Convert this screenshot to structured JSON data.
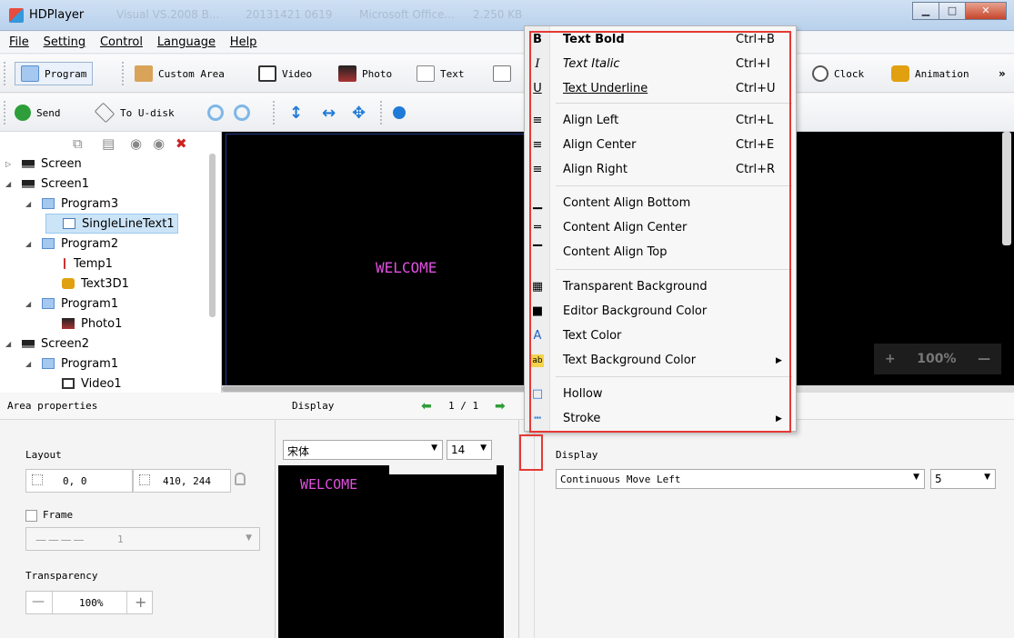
{
  "window": {
    "title": "HDPlayer",
    "ghost_tabs": [
      "Visual VS.2008 B...",
      "20131421 0619",
      "Microsoft Office...",
      "2.250 KB"
    ]
  },
  "menubar": [
    "File",
    "Setting",
    "Control",
    "Language",
    "Help"
  ],
  "toolbar1": {
    "program": "Program",
    "custom_area": "Custom Area",
    "video": "Video",
    "photo": "Photo",
    "text": "Text",
    "clock": "Clock",
    "animation": "Animation",
    "more": "»"
  },
  "toolbar2": {
    "send": "Send",
    "to_udisk": "To U-disk"
  },
  "tree": [
    {
      "label": "Screen",
      "level": 0,
      "arrow": "▷",
      "icon": "monitor-icon"
    },
    {
      "label": "Screen1",
      "level": 0,
      "arrow": "◢",
      "icon": "monitor-icon"
    },
    {
      "label": "Program3",
      "level": 1,
      "arrow": "◢",
      "icon": "program-icon"
    },
    {
      "label": "SingleLineText1",
      "level": 2,
      "arrow": "",
      "icon": "text-icon",
      "selected": true
    },
    {
      "label": "Program2",
      "level": 1,
      "arrow": "◢",
      "icon": "program-icon"
    },
    {
      "label": "Temp1",
      "level": 2,
      "arrow": "",
      "icon": "thermometer-icon"
    },
    {
      "label": "Text3D1",
      "level": 2,
      "arrow": "",
      "icon": "text3d-icon"
    },
    {
      "label": "Program1",
      "level": 1,
      "arrow": "◢",
      "icon": "program-icon"
    },
    {
      "label": "Photo1",
      "level": 2,
      "arrow": "",
      "icon": "photo-icon"
    },
    {
      "label": "Screen2",
      "level": 0,
      "arrow": "◢",
      "icon": "monitor-icon"
    },
    {
      "label": "Program1",
      "level": 1,
      "arrow": "◢",
      "icon": "program-icon"
    },
    {
      "label": "Video1",
      "level": 2,
      "arrow": "",
      "icon": "video-icon"
    }
  ],
  "canvas": {
    "text": "WELCOME",
    "zoom": "100%",
    "zoom_in": "+",
    "zoom_out": "—"
  },
  "area": {
    "header": "Area properties",
    "layout_label": "Layout",
    "position": "0, 0",
    "size": "410, 244",
    "frame_label": "Frame",
    "frame_value": "1",
    "transparency_label": "Transparency",
    "transparency_value": "100%",
    "minus": "—",
    "plus": "+"
  },
  "display": {
    "header": "Display",
    "page": "1 / 1",
    "font": "宋体",
    "font_size": "14",
    "preview_text": "WELCOME",
    "expand": "»"
  },
  "right_panel": {
    "display_label": "Display",
    "effect": "Continuous Move Left",
    "speed": "5"
  },
  "context_menu": [
    {
      "label": "Text Bold",
      "shortcut": "Ctrl+B",
      "icon": "bold-icon",
      "glyph": "B"
    },
    {
      "label": "Text Italic",
      "shortcut": "Ctrl+I",
      "icon": "italic-icon",
      "glyph": "I"
    },
    {
      "label": "Text Underline",
      "shortcut": "Ctrl+U",
      "icon": "underline-icon",
      "glyph": "U"
    },
    {
      "label": "Align Left",
      "shortcut": "Ctrl+L",
      "icon": "align-left-icon",
      "glyph": "≡"
    },
    {
      "label": "Align Center",
      "shortcut": "Ctrl+E",
      "icon": "align-center-icon",
      "glyph": "≡"
    },
    {
      "label": "Align Right",
      "shortcut": "Ctrl+R",
      "icon": "align-right-icon",
      "glyph": "≡"
    },
    {
      "label": "Content Align Bottom",
      "shortcut": "",
      "icon": "content-bottom-icon",
      "glyph": "▁"
    },
    {
      "label": "Content Align Center",
      "shortcut": "",
      "icon": "content-center-icon",
      "glyph": "═"
    },
    {
      "label": "Content Align Top",
      "shortcut": "",
      "icon": "content-top-icon",
      "glyph": "▔"
    },
    {
      "label": "Transparent Background",
      "shortcut": "",
      "icon": "transparent-bg-icon",
      "glyph": "▦"
    },
    {
      "label": "Editor Background Color",
      "shortcut": "",
      "icon": "editor-bg-color-icon",
      "glyph": "■"
    },
    {
      "label": "Text Color",
      "shortcut": "",
      "icon": "text-color-icon",
      "glyph": "A"
    },
    {
      "label": "Text Background Color",
      "shortcut": "",
      "icon": "text-bg-color-icon",
      "glyph": "ab",
      "submenu": true
    },
    {
      "label": "Hollow",
      "shortcut": "",
      "icon": "hollow-icon",
      "glyph": "□"
    },
    {
      "label": "Stroke",
      "shortcut": "",
      "icon": "stroke-icon",
      "glyph": "┅",
      "submenu": true
    }
  ],
  "colors": {
    "accent": "#e53935",
    "welcome": "#e050e0",
    "selection": "#cce4f7"
  }
}
